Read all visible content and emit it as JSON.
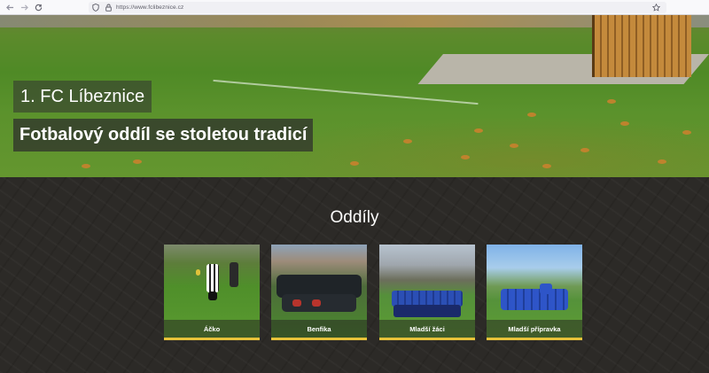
{
  "browser": {
    "url": "https://www.fclibeznice.cz"
  },
  "hero": {
    "title": "1. FC Líbeznice",
    "subtitle": "Fotbalový oddíl se stoletou tradicí"
  },
  "section": {
    "title": "Oddíly"
  },
  "cards": [
    {
      "label": "Áčko"
    },
    {
      "label": "Benfika"
    },
    {
      "label": "Mladší žáci"
    },
    {
      "label": "Mladší přípravka"
    }
  ]
}
